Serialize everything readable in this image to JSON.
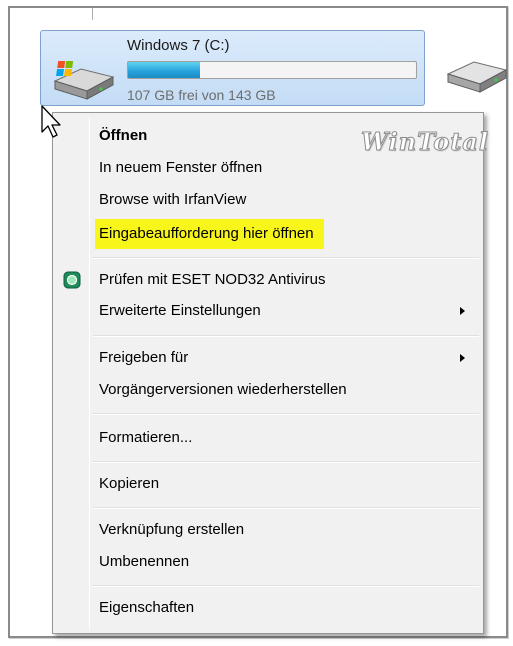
{
  "drive": {
    "name": "Windows 7 (C:)",
    "free_text": "107 GB frei von 143 GB",
    "used_fraction": 0.25,
    "bar_color": "#26a0da",
    "icon": "hard-drive-windows-icon"
  },
  "second_drive": {
    "icon": "hard-drive-icon"
  },
  "watermark": "WinTotal",
  "context_menu": {
    "items": [
      {
        "label": "Öffnen",
        "bold": true
      },
      {
        "label": "In neuem Fenster öffnen"
      },
      {
        "label": "Browse with IrfanView"
      },
      {
        "label": "Eingabeaufforderung hier öffnen",
        "highlighted": true,
        "highlight_color": "#f8f51a"
      },
      {
        "label": "Prüfen mit ESET NOD32 Antivirus",
        "icon": "eset-icon"
      },
      {
        "label": "Erweiterte Einstellungen",
        "submenu": true
      },
      {
        "label": "Freigeben für",
        "submenu": true
      },
      {
        "label": "Vorgängerversionen wiederherstellen"
      },
      {
        "label": "Formatieren..."
      },
      {
        "label": "Kopieren"
      },
      {
        "label": "Verknüpfung erstellen"
      },
      {
        "label": "Umbenennen"
      },
      {
        "label": "Eigenschaften"
      }
    ]
  }
}
